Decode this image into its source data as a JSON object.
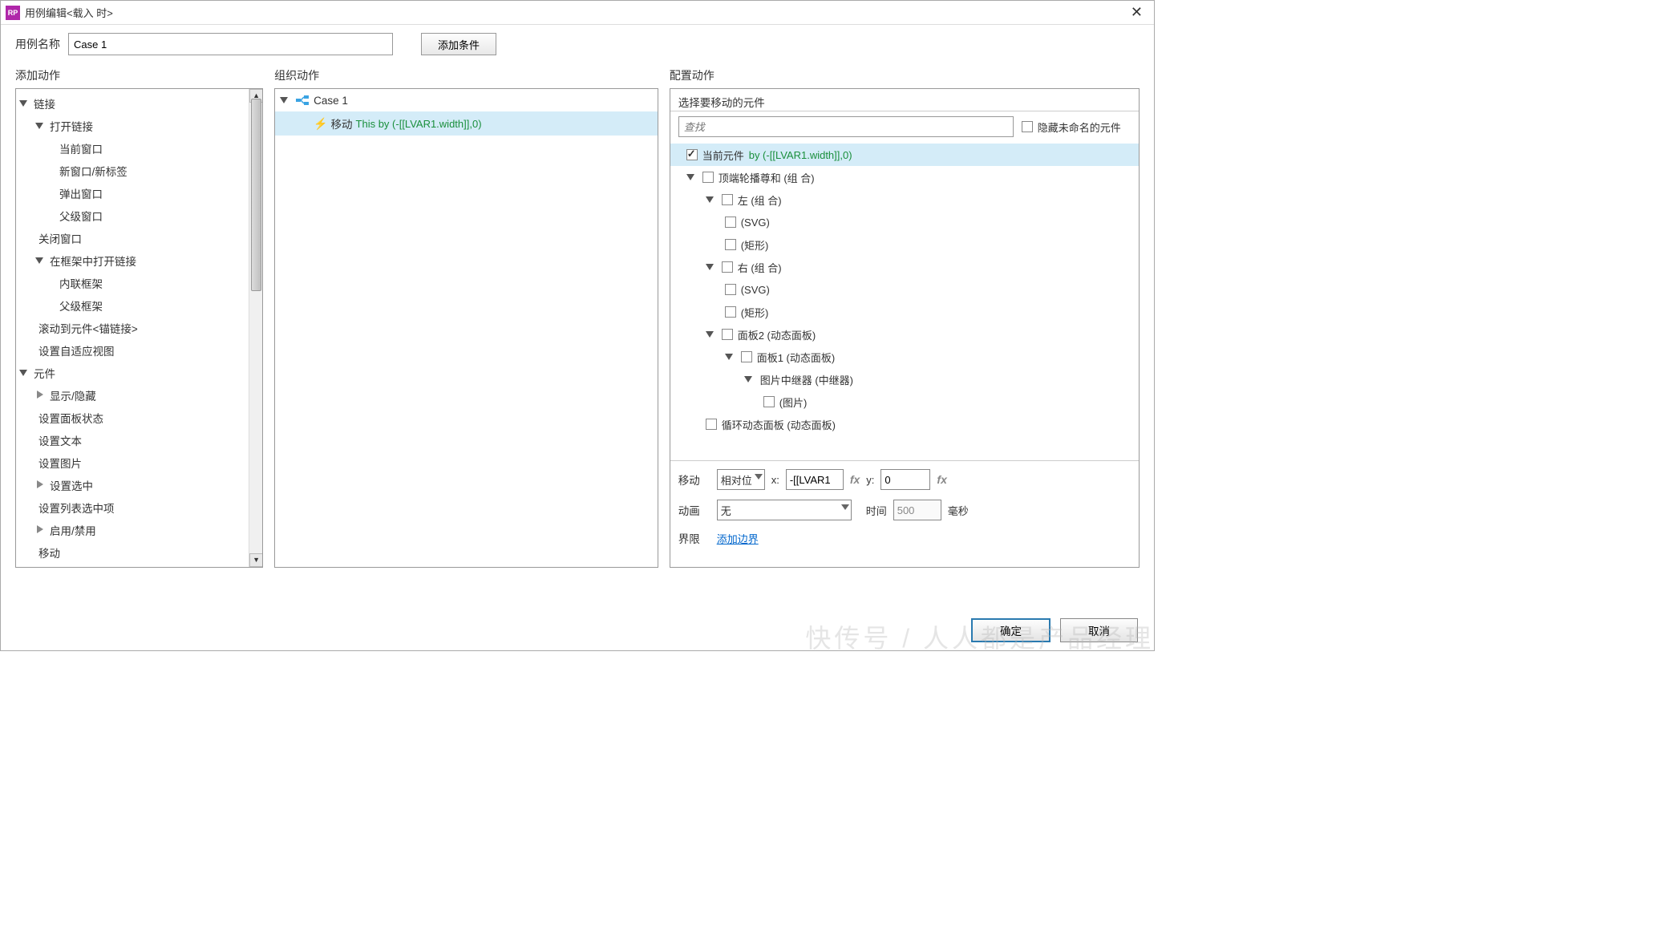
{
  "title": "用例编辑<载入 时>",
  "caseNameLabel": "用例名称",
  "caseName": "Case 1",
  "addCondition": "添加条件",
  "columns": {
    "addAction": "添加动作",
    "organize": "组织动作",
    "configure": "配置动作"
  },
  "actionTree": {
    "links": "链接",
    "openLink": "打开链接",
    "currentWindow": "当前窗口",
    "newWindowTab": "新窗口/新标签",
    "popup": "弹出窗口",
    "parentWindow": "父级窗口",
    "closeWindow": "关闭窗口",
    "openInFrame": "在框架中打开链接",
    "inlineFrame": "内联框架",
    "parentFrame": "父级框架",
    "scrollToAnchor": "滚动到元件<锚链接>",
    "adaptiveView": "设置自适应视图",
    "widgets": "元件",
    "showHide": "显示/隐藏",
    "setPanelState": "设置面板状态",
    "setText": "设置文本",
    "setImage": "设置图片",
    "setSelected": "设置选中",
    "setListSelected": "设置列表选中项",
    "enableDisable": "启用/禁用",
    "move": "移动"
  },
  "caseTree": {
    "case": "Case 1",
    "action": "移动",
    "param": "This by (-[[LVAR1.width]],0)"
  },
  "configure": {
    "selectPrompt": "选择要移动的元件",
    "searchPlaceholder": "查找",
    "hideUnnamed": "隐藏未命名的元件",
    "current": "当前元件",
    "currentParam": "by (-[[LVAR1.width]],0)",
    "topCarousel": "顶端轮播尊和 (组 合)",
    "leftGroup": "左 (组 合)",
    "svg": "(SVG)",
    "rect": "(矩形)",
    "rightGroup": "右 (组 合)",
    "panel2": "面板2 (动态面板)",
    "panel1": "面板1 (动态面板)",
    "repeater": "图片中继器 (中继器)",
    "image": "(图片)",
    "loopPanel": "循环动态面板 (动态面板)",
    "moveLabel": "移动",
    "moveMode": "相对位",
    "xLabel": "x:",
    "xVal": "-[[LVAR1",
    "yLabel": "y:",
    "yVal": "0",
    "animLabel": "动画",
    "animMode": "无",
    "timeLabel": "时间",
    "timeVal": "500",
    "msLabel": "毫秒",
    "boundsLabel": "界限",
    "addBounds": "添加边界"
  },
  "buttons": {
    "ok": "确定",
    "cancel": "取消"
  },
  "watermark": "快传号 / 人人都是产品经理"
}
